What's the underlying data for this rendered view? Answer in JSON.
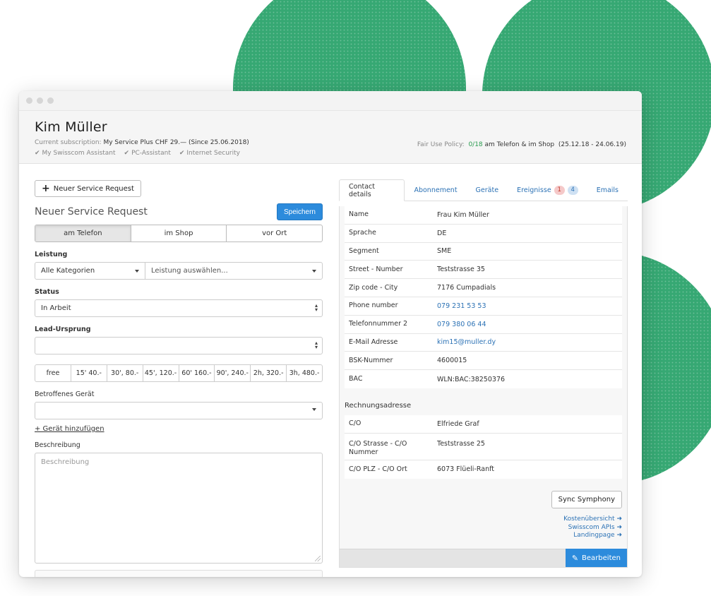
{
  "customer": {
    "name": "Kim Müller",
    "subscription_label": "Current subscription:",
    "subscription_value": "My Service Plus CHF 29.— (Since 25.06.2018)",
    "features": [
      "My Swisscom Assistant",
      "PC-Assistant",
      "Internet Security"
    ],
    "fup_label": "Fair Use Policy:",
    "fup_count": "0/18",
    "fup_text": "am Telefon & im Shop",
    "fup_period": "(25.12.18 - 24.06.19)"
  },
  "form": {
    "new_button": "Neuer Service Request",
    "title": "Neuer Service Request",
    "save_button": "Speichern",
    "channels": [
      "am Telefon",
      "im Shop",
      "vor Ort"
    ],
    "active_channel": "am Telefon",
    "leistung_label": "Leistung",
    "category_value": "Alle Kategorien",
    "leistung_placeholder": "Leistung auswählen...",
    "status_label": "Status",
    "status_value": "In Arbeit",
    "lead_label": "Lead-Ursprung",
    "lead_value": "",
    "durations": [
      "free",
      "15' 40.-",
      "30', 80.-",
      "45', 120.-",
      "60' 160.-",
      "90', 240.-",
      "2h, 320.-",
      "3h, 480.-"
    ],
    "device_label": "Betroffenes Gerät",
    "device_value": "",
    "add_device_link": "+ Gerät hinzufügen",
    "description_label": "Beschreibung",
    "description_placeholder": "Beschreibung"
  },
  "tabs": {
    "contact": "Contact details",
    "abo": "Abonnement",
    "devices": "Geräte",
    "events": "Ereignisse",
    "events_badge_red": "1",
    "events_badge_blue": "4",
    "emails": "Emails"
  },
  "contact": {
    "rows": [
      {
        "k": "Name",
        "v": "Frau Kim Müller"
      },
      {
        "k": "Sprache",
        "v": "DE"
      },
      {
        "k": "Segment",
        "v": "SME"
      },
      {
        "k": "Street - Number",
        "v": "Teststrasse 35"
      },
      {
        "k": "Zip code - City",
        "v": "7176 Cumpadials"
      },
      {
        "k": "Phone number",
        "v": "079 231 53 53"
      },
      {
        "k": "Telefonnummer 2",
        "v": "079 380 06 44"
      },
      {
        "k": "E-Mail Adresse",
        "v": "kim15@muller.dy"
      },
      {
        "k": "BSK-Nummer",
        "v": "4600015"
      },
      {
        "k": "BAC",
        "v": "WLN:BAC:38250376"
      }
    ],
    "billing_title": "Rechnungsadresse",
    "billing_rows": [
      {
        "k": "C/O",
        "v": "Elfriede Graf"
      },
      {
        "k": "C/O Strasse - C/O Nummer",
        "v": "Teststrasse 25"
      },
      {
        "k": "C/O PLZ - C/O Ort",
        "v": "6073 Flüeli-Ranft"
      }
    ],
    "sync_button": "Sync Symphony",
    "links": [
      "Kostenübersicht",
      "Swisscom APIs",
      "Landingpage"
    ],
    "edit_button": "Bearbeiten"
  },
  "colors": {
    "accent": "#2c8bdc",
    "link": "#2c72b5",
    "brand_green": "#36a873",
    "fup_green": "#2a9c4f"
  }
}
